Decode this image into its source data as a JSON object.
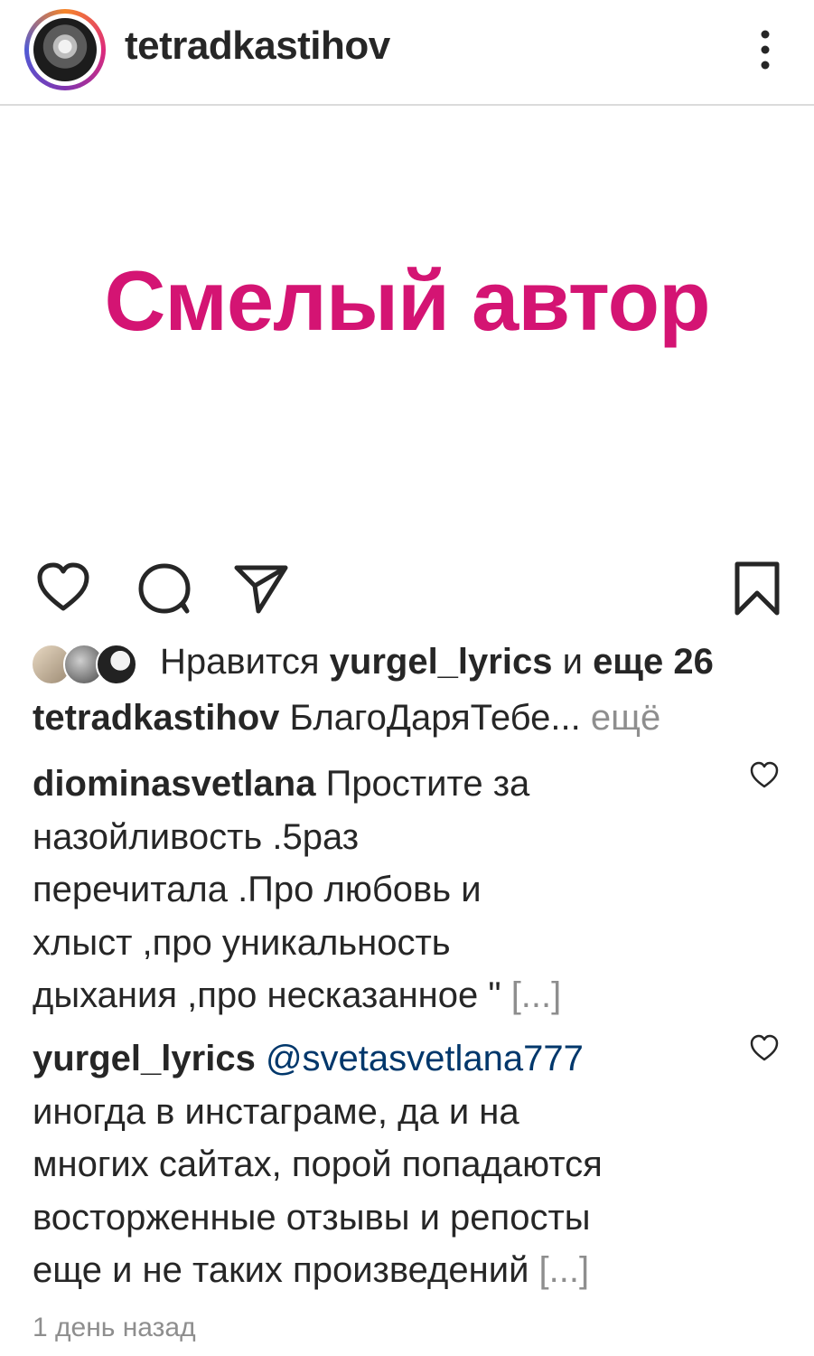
{
  "post": {
    "username": "tetradkastihov",
    "image_title": "Смелый автор",
    "likes": {
      "prefix": "Нравится",
      "user": "yurgel_lyrics",
      "connector": "и",
      "others": "еще 26"
    },
    "caption": {
      "username": "tetradkastihov",
      "text": "БлагоДаряТебе...",
      "more": "ещё"
    },
    "comments": [
      {
        "username": "diominasvetlana",
        "lines": [
          "Простите за",
          "назойливость .5раз",
          "перечитала .Про любовь и",
          "хлыст ,про уникальность",
          "дыхания ,про несказанное \""
        ],
        "truncation": "[...]"
      },
      {
        "username": "yurgel_lyrics",
        "mention": "@svetasvetlana777",
        "lines": [
          "иногда в инстаграме, да и на",
          "многих сайтах, порой попадаются",
          "восторженные отзывы и репосты",
          "еще и не таких произведений"
        ],
        "truncation": "[...]"
      }
    ],
    "timestamp": "1 день назад"
  },
  "colors": {
    "title_magenta": "#d41473",
    "mention_blue": "#00376b",
    "muted_gray": "#8e8e8e",
    "divider": "#dbdbdb"
  },
  "icons": [
    "more-vertical-icon",
    "heart-icon",
    "comment-icon",
    "share-icon",
    "bookmark-icon",
    "comment-like-icon"
  ]
}
